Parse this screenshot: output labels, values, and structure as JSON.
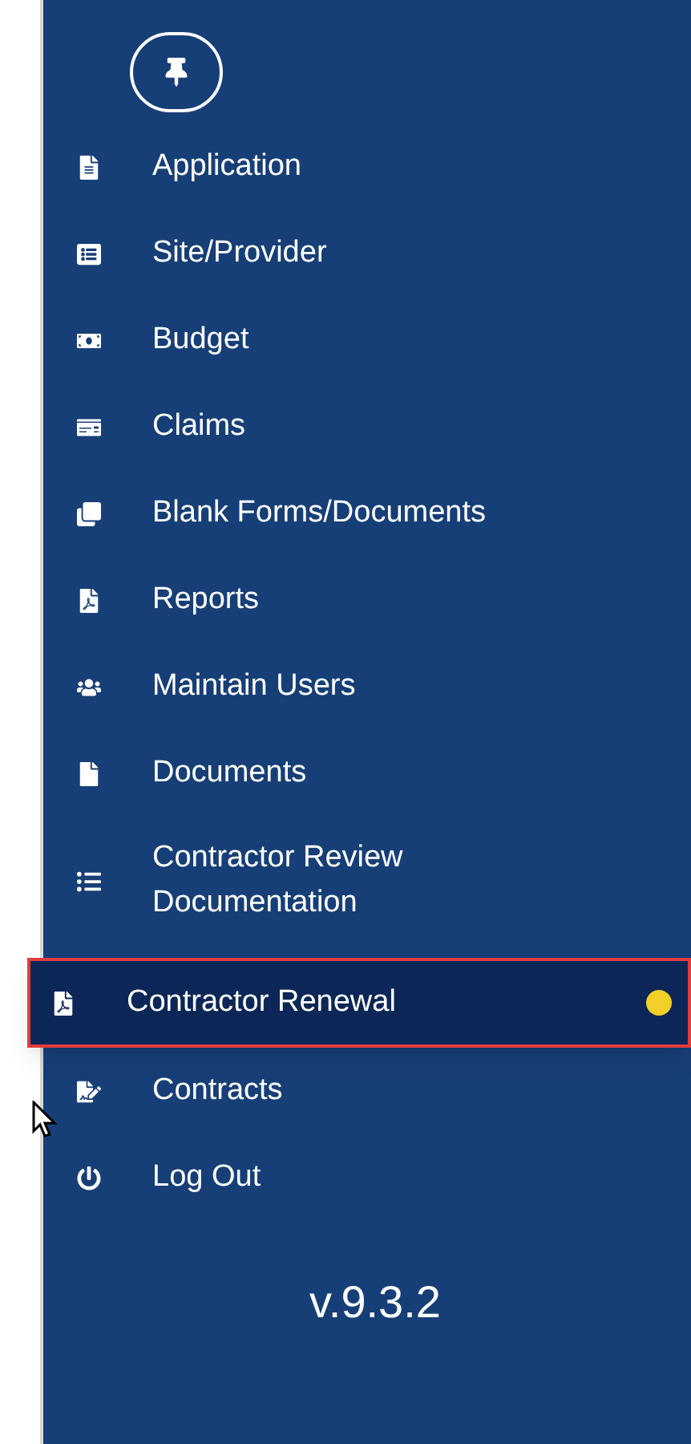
{
  "sidebar": {
    "items": [
      {
        "label": "Application",
        "selected": false,
        "highlighted": false
      },
      {
        "label": "Site/Provider",
        "selected": false,
        "highlighted": false
      },
      {
        "label": "Budget",
        "selected": false,
        "highlighted": false
      },
      {
        "label": "Claims",
        "selected": false,
        "highlighted": false
      },
      {
        "label": "Blank Forms/Documents",
        "selected": false,
        "highlighted": false
      },
      {
        "label": "Reports",
        "selected": false,
        "highlighted": false
      },
      {
        "label": "Maintain Users",
        "selected": false,
        "highlighted": false
      },
      {
        "label": "Documents",
        "selected": false,
        "highlighted": false
      },
      {
        "label": "Contractor Review Documentation",
        "selected": false,
        "highlighted": false
      },
      {
        "label": "Contractor Renewal",
        "selected": true,
        "highlighted": true,
        "color": "#f2d027"
      },
      {
        "label": "Contracts",
        "selected": false,
        "highlighted": false
      },
      {
        "label": "Log Out",
        "selected": false,
        "highlighted": false
      }
    ],
    "version": "v.9.3.2"
  }
}
